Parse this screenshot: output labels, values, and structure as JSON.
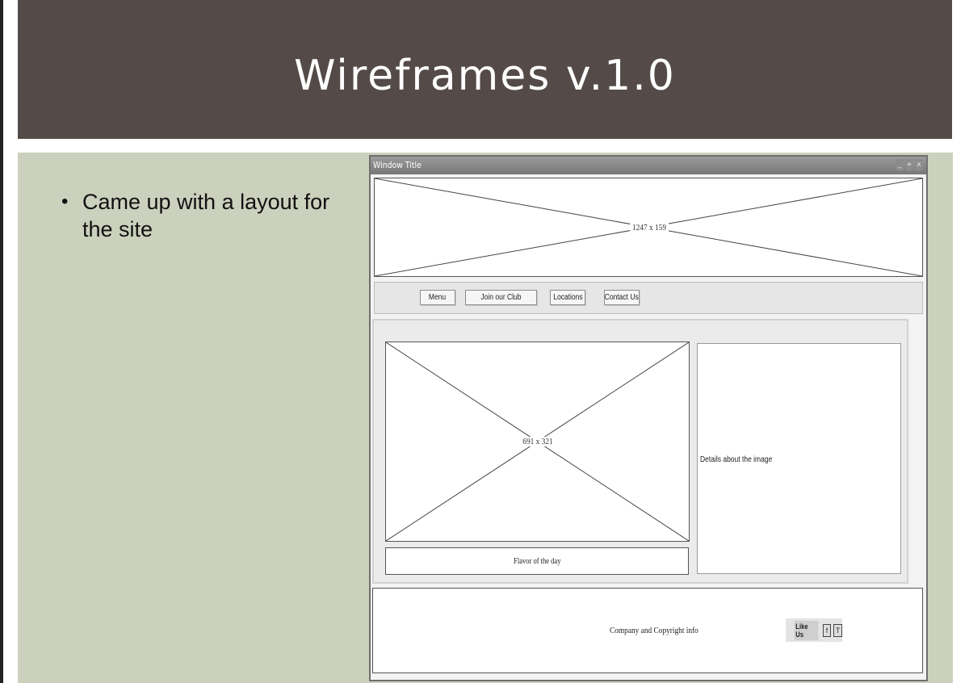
{
  "slide": {
    "title": "Wireframes v.1.0",
    "bullets": [
      "Came up with a layout for the site"
    ]
  },
  "wireframe": {
    "window_title": "Window Title",
    "window_controls": [
      "_",
      "+",
      "x"
    ],
    "banner_label": "1247 x 159",
    "nav_items": [
      "Menu",
      "Join our Club",
      "Locations",
      "Contact Us"
    ],
    "feature_image_label": "691 x 321",
    "flavor_label": "Flavor of the day",
    "details_label": "Details about the image",
    "footer_label": "Company and Copyright info",
    "like_label": "Like Us",
    "social_icons": [
      "f",
      "T"
    ]
  }
}
